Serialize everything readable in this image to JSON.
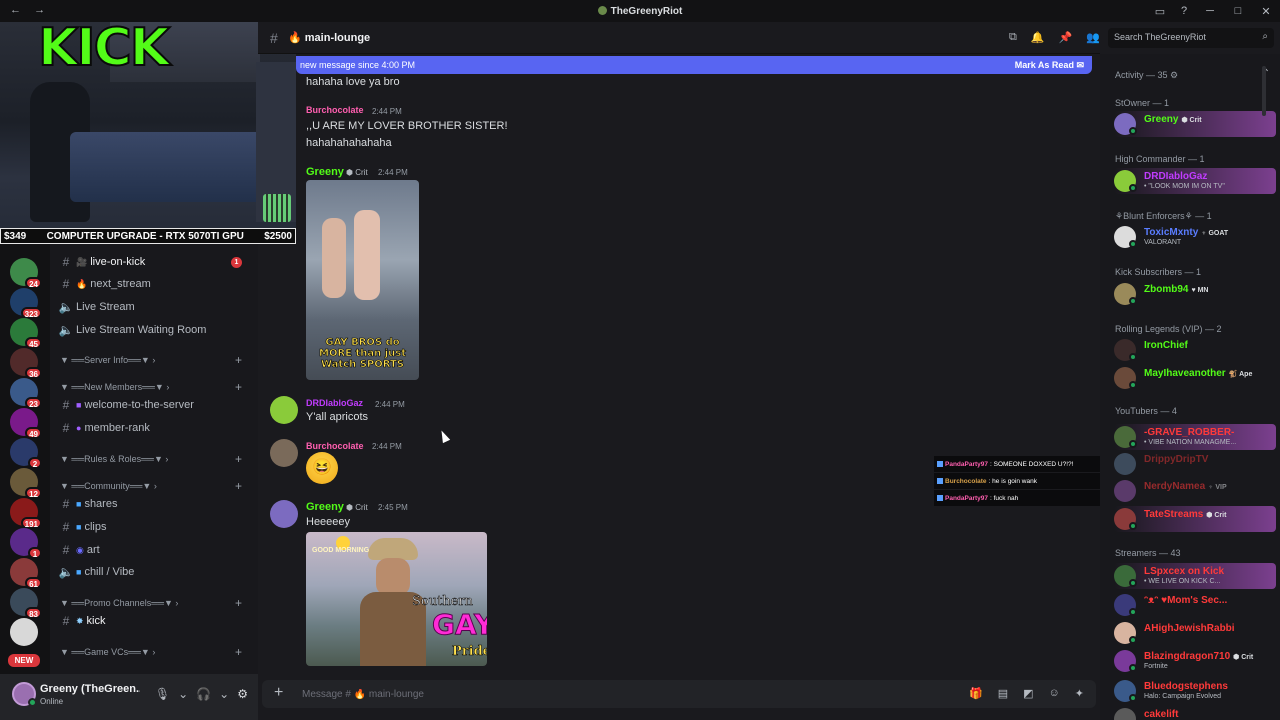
{
  "titlebar": {
    "title": "TheGreenyRiot",
    "back": "←",
    "forward": "→"
  },
  "stream_overlay": {
    "logo": "KICK",
    "goal_left": "$349",
    "goal_text": "COMPUTER UPGRADE - RTX 5070TI GPU",
    "goal_right": "$2500"
  },
  "rail": {
    "home_icon": "discord-icon",
    "badges": [
      "24",
      "323",
      "45",
      "36",
      "23",
      "49",
      "2",
      "12",
      "191",
      "1",
      "61",
      "83"
    ],
    "new_badge": "NEW"
  },
  "channels": [
    {
      "name": "live-on-kick",
      "icon": "🎥",
      "type": "text",
      "unread": "1"
    },
    {
      "name": "next_stream",
      "icon": "🔥",
      "type": "text"
    },
    {
      "name": "Live Stream",
      "type": "voice"
    },
    {
      "name": "Live Stream Waiting Room",
      "type": "voice"
    }
  ],
  "categories": {
    "server_info": "▼ ══Server Info══▼  ›",
    "new_members": "▼ ══New Members══▼  ›",
    "rules_roles": "▼ ══Rules & Roles══▼  ›",
    "community": "▼ ══Community══▼  ›",
    "promo": "▼ ══Promo Channels══▼  ›",
    "game_vcs": "▼ ══Game VCs══▼  ›"
  },
  "channels2": {
    "welcome": "welcome-to-the-server",
    "member_rank": "member-rank",
    "shares": "shares",
    "clips": "clips",
    "art": "art",
    "chill": "chill / Vibe",
    "kick": "kick"
  },
  "user": {
    "name": "Greeny (TheGreen...",
    "status": "Online"
  },
  "header": {
    "channel": "main-lounge",
    "channel_emoji": "🔥"
  },
  "search": {
    "placeholder": "Search TheGreenyRiot"
  },
  "new_messages_bar": {
    "text": "new message since 4:00 PM",
    "action": "Mark As Read"
  },
  "messages": [
    {
      "text": "hahaha love ya bro"
    },
    {
      "author": "Burchocolate",
      "time": "2:44 PM",
      "lines": [
        ",,U ARE MY LOVER BROTHER SISTER!",
        "hahahahahahaha"
      ]
    },
    {
      "author": "Greeny",
      "role": "Crit",
      "time": "2:44 PM",
      "media_caption": "GAY BROS do MORE than just Watch SPORTS"
    },
    {
      "author": "DRDIabloGaz",
      "time": "2:44 PM",
      "text": "Y'all apricots"
    },
    {
      "author": "Burchocolate",
      "time": "2:44 PM",
      "emoji": "😆"
    },
    {
      "author": "Greeny",
      "role": "Crit",
      "time": "2:45 PM",
      "text": "Heeeeey",
      "media_top": "GOOD MORNING",
      "media_line1": "Southern",
      "media_line2": "GAY",
      "media_line3": "Pride"
    }
  ],
  "composer": {
    "placeholder": "Message # 🔥 main-lounge"
  },
  "overlay_chat": [
    {
      "user": "PandaParty97",
      "text": ": SOMEONE DOXXED U?!?!"
    },
    {
      "user": "Burchocolate",
      "text": ": he is goin wank"
    },
    {
      "user": "PandaParty97",
      "text": ": fuck nah"
    }
  ],
  "member_list": {
    "activity": "Activity — 35 ⚙",
    "groups": [
      {
        "title": "StOwner — 1",
        "members": [
          {
            "name": "Greeny",
            "tag": "Crit",
            "color": "#53fc18"
          }
        ]
      },
      {
        "title": "High Commander — 1",
        "members": [
          {
            "name": "DRDIabloGaz",
            "sub": "• \"LOOK MOM IM ON TV\"",
            "color": "#c13cff"
          }
        ]
      },
      {
        "title": "⚘Blunt Enforcers⚘ — 1",
        "members": [
          {
            "name": "ToxicMxnty",
            "tag": "GOAT",
            "sub": "VALORANT",
            "color": "#5a7dff"
          }
        ]
      },
      {
        "title": "Kick Subscribers — 1",
        "members": [
          {
            "name": "Zbomb94",
            "tag": "MN",
            "color": "#53fc18"
          }
        ]
      },
      {
        "title": "Rolling Legends (VIP) — 2",
        "members": [
          {
            "name": "IronChief",
            "color": "#53fc18"
          },
          {
            "name": "MayIhaveanother",
            "tag": "Ape",
            "color": "#53fc18"
          }
        ]
      },
      {
        "title": "YouTubers — 4",
        "members": [
          {
            "name": "-GRAVE_ROBBER-",
            "sub": "• VIBE NATION MANAGME...",
            "color": "#ff3a3a"
          },
          {
            "name": "DrippyDripTV",
            "color": "#ff3a3a"
          },
          {
            "name": "NerdyNamea",
            "tag": "VIP",
            "color": "#ff3a3a"
          },
          {
            "name": "TateStreams",
            "tag": "Crit",
            "color": "#ff3a3a"
          }
        ]
      },
      {
        "title": "Streamers — 43",
        "members": [
          {
            "name": "LSpxcex on Kick",
            "sub": "• WE LIVE ON KICK C...",
            "color": "#ff3a3a"
          },
          {
            "name": "ᵔᴥᵔ ♥Mom's Sec...",
            "color": "#ff3a3a"
          },
          {
            "name": "AHighJewishRabbi",
            "color": "#ff3a3a"
          },
          {
            "name": "Blazingdragon710",
            "tag": "Crit",
            "sub": "Fortnite",
            "color": "#ff3a3a"
          },
          {
            "name": "Bluedogstephens",
            "sub": "Halo: Campaign Evolved",
            "color": "#ff3a3a"
          },
          {
            "name": "cakelift",
            "color": "#ff3a3a"
          }
        ]
      }
    ]
  }
}
